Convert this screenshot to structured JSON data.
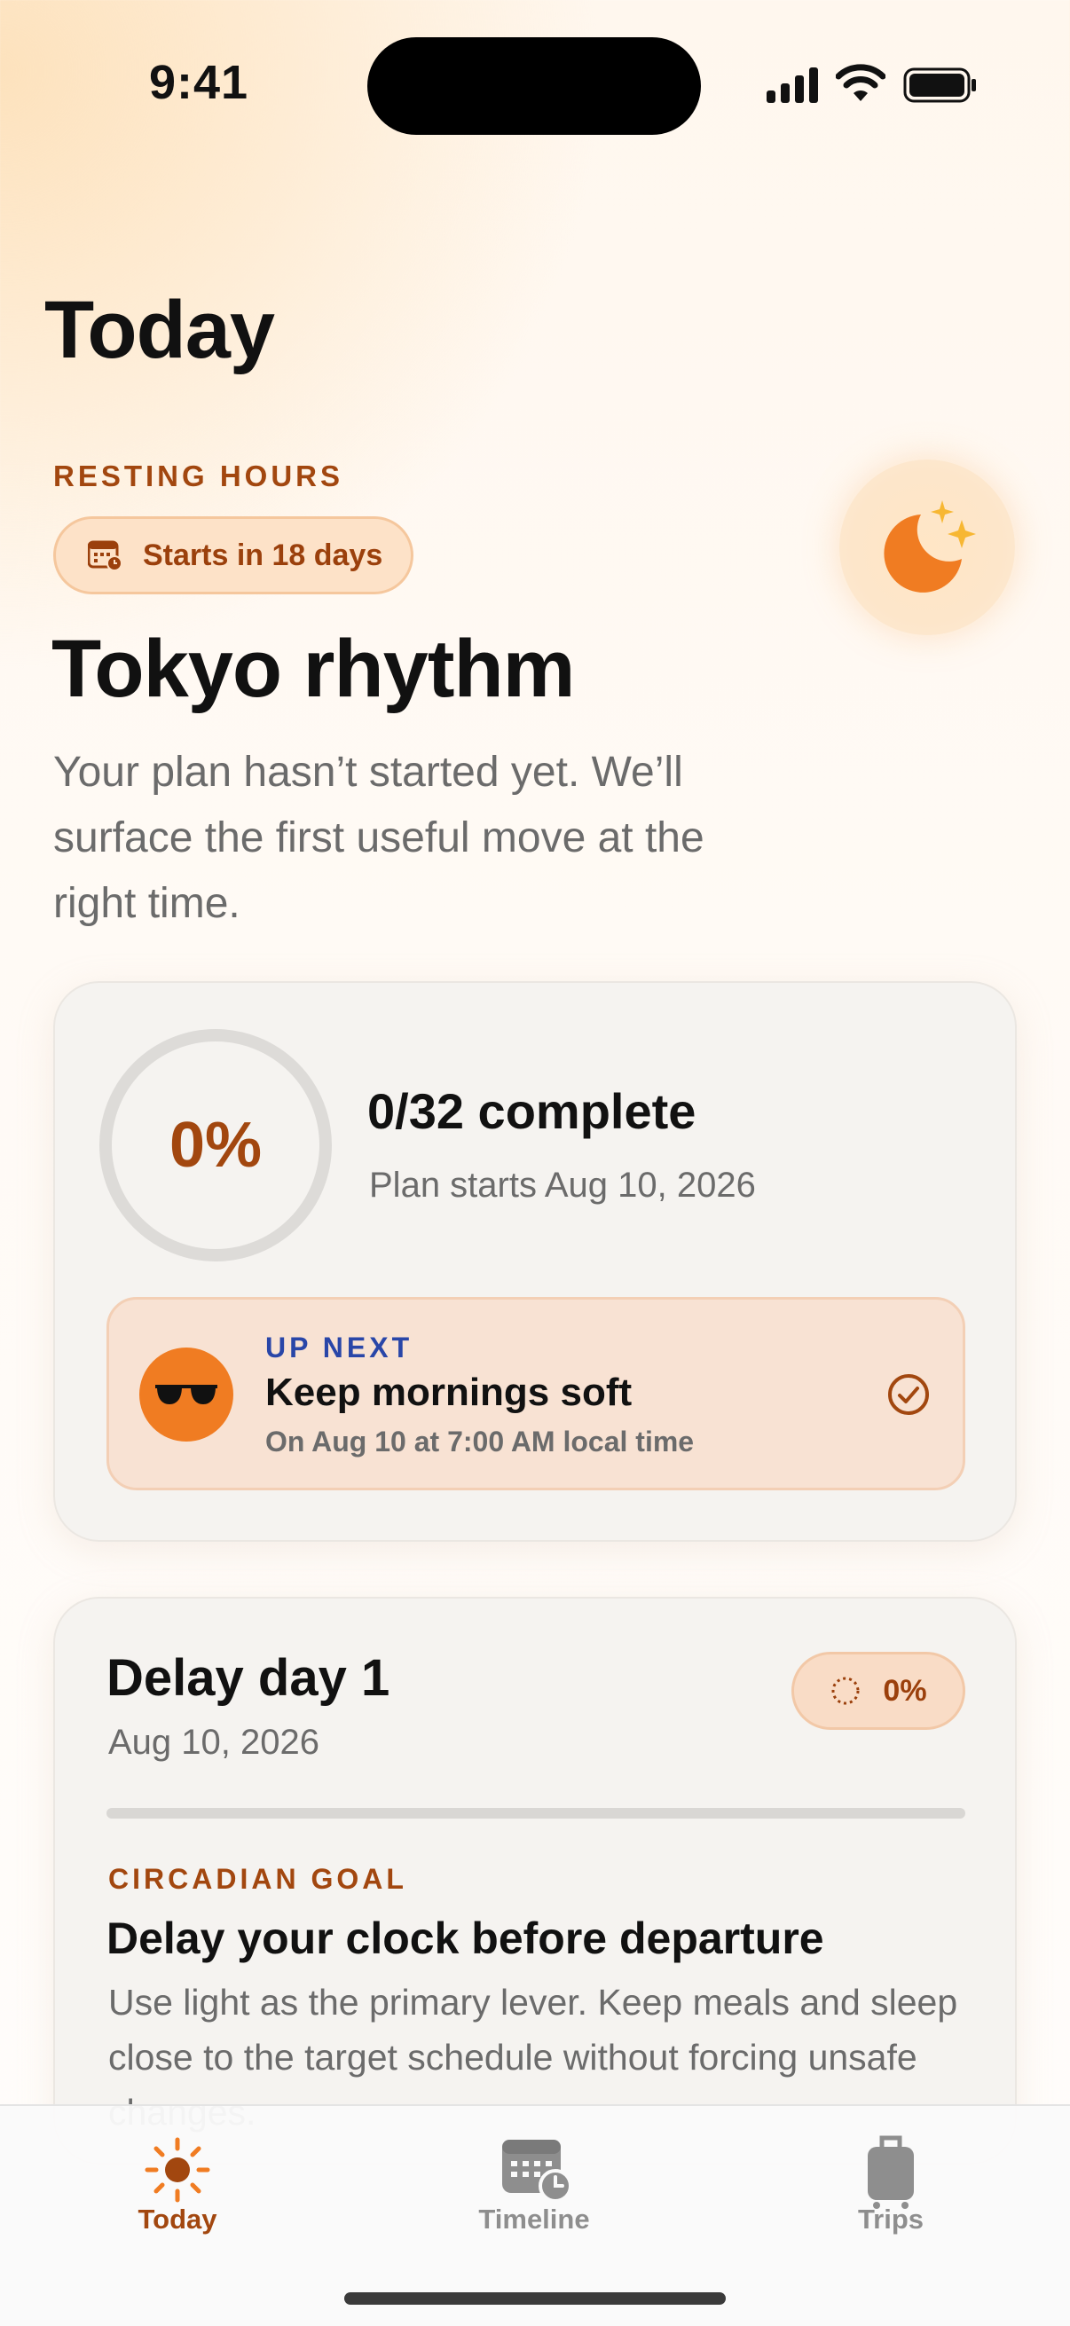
{
  "status_bar": {
    "time": "9:41",
    "icons": [
      "cellular-signal-icon",
      "wifi-icon",
      "battery-icon"
    ]
  },
  "page": {
    "title": "Today"
  },
  "hero": {
    "eyebrow": "RESTING HOURS",
    "start_pill": {
      "icon": "calendar-clock-icon",
      "label": "Starts in 18 days"
    },
    "badge_icon": "moon-stars-icon",
    "title": "Tokyo rhythm",
    "subtitle": "Your plan hasn’t started yet. We’ll surface the first useful move at the right time."
  },
  "progress_card": {
    "percent_label": "0%",
    "percent_value": 0,
    "complete_label": "0/32 complete",
    "plan_start": "Plan starts Aug 10, 2026",
    "up_next": {
      "icon": "sunglasses-icon",
      "label": "UP NEXT",
      "title": "Keep mornings soft",
      "time": "On Aug 10 at 7:00 AM local time",
      "action_icon": "checkmark-circle-icon"
    }
  },
  "delay_card": {
    "title": "Delay day 1",
    "date": "Aug 10, 2026",
    "pill": {
      "icon": "progress-dotted-circle-icon",
      "label": "0%"
    },
    "progress_value": 0,
    "goal_label": "CIRCADIAN GOAL",
    "goal_title": "Delay your clock before departure",
    "goal_body": "Use light as the primary lever. Keep meals and sleep close to the target schedule without forcing unsafe changes."
  },
  "tab_bar": {
    "tabs": [
      {
        "label": "Today",
        "icon": "sun-icon",
        "selected": true
      },
      {
        "label": "Timeline",
        "icon": "calendar-clock-icon",
        "selected": false
      },
      {
        "label": "Trips",
        "icon": "suitcase-icon",
        "selected": false
      }
    ]
  },
  "colors": {
    "accent": "#f07c22",
    "accent_dark": "#a2470f",
    "up_next_label": "#2946a8"
  }
}
